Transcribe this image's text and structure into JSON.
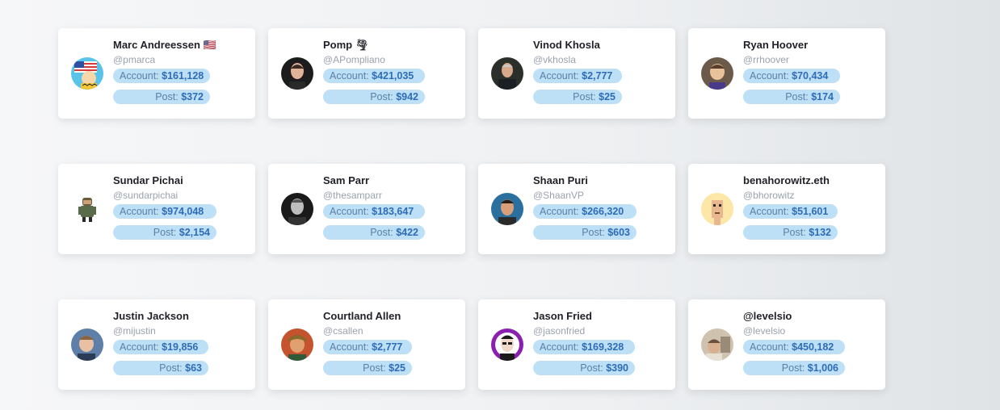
{
  "labels": {
    "account": "Account: ",
    "post": "Post: "
  },
  "cards": [
    {
      "name": "Marc Andreessen 🇺🇸",
      "handle": "@pmarca",
      "account": "$161,128",
      "post": "$372",
      "avatar_icon": "charlie-brown-flag-avatar"
    },
    {
      "name": "Pomp 🌪",
      "handle": "@APompliano",
      "account": "$421,035",
      "post": "$942",
      "avatar_icon": "man-portrait-avatar"
    },
    {
      "name": "Vinod Khosla",
      "handle": "@vkhosla",
      "account": "$2,777",
      "post": "$25",
      "avatar_icon": "man-portrait-avatar"
    },
    {
      "name": "Ryan Hoover",
      "handle": "@rrhoover",
      "account": "$70,434",
      "post": "$174",
      "avatar_icon": "man-portrait-avatar"
    },
    {
      "name": "Sundar Pichai",
      "handle": "@sundarpichai",
      "account": "$974,048",
      "post": "$2,154",
      "avatar_icon": "android-figure-avatar"
    },
    {
      "name": "Sam Parr",
      "handle": "@thesamparr",
      "account": "$183,647",
      "post": "$422",
      "avatar_icon": "man-portrait-avatar"
    },
    {
      "name": "Shaan Puri",
      "handle": "@ShaanVP",
      "account": "$266,320",
      "post": "$603",
      "avatar_icon": "man-portrait-avatar"
    },
    {
      "name": "benahorowitz.eth",
      "handle": "@bhorowitz",
      "account": "$51,601",
      "post": "$132",
      "avatar_icon": "pixel-punk-avatar"
    },
    {
      "name": "Justin Jackson",
      "handle": "@mijustin",
      "account": "$19,856",
      "post": "$63",
      "avatar_icon": "man-portrait-avatar"
    },
    {
      "name": "Courtland Allen",
      "handle": "@csallen",
      "account": "$2,777",
      "post": "$25",
      "avatar_icon": "man-portrait-avatar"
    },
    {
      "name": "Jason Fried",
      "handle": "@jasonfried",
      "account": "$169,328",
      "post": "$390",
      "avatar_icon": "man-portrait-avatar"
    },
    {
      "name": "@levelsio",
      "handle": "@levelsio",
      "account": "$450,182",
      "post": "$1,006",
      "avatar_icon": "man-portrait-avatar"
    }
  ],
  "colors": {
    "pill_bg": "#bde0f7",
    "pill_value": "#2e6cb6",
    "pill_label": "#5a80a6",
    "handle": "#9aa2ad"
  }
}
